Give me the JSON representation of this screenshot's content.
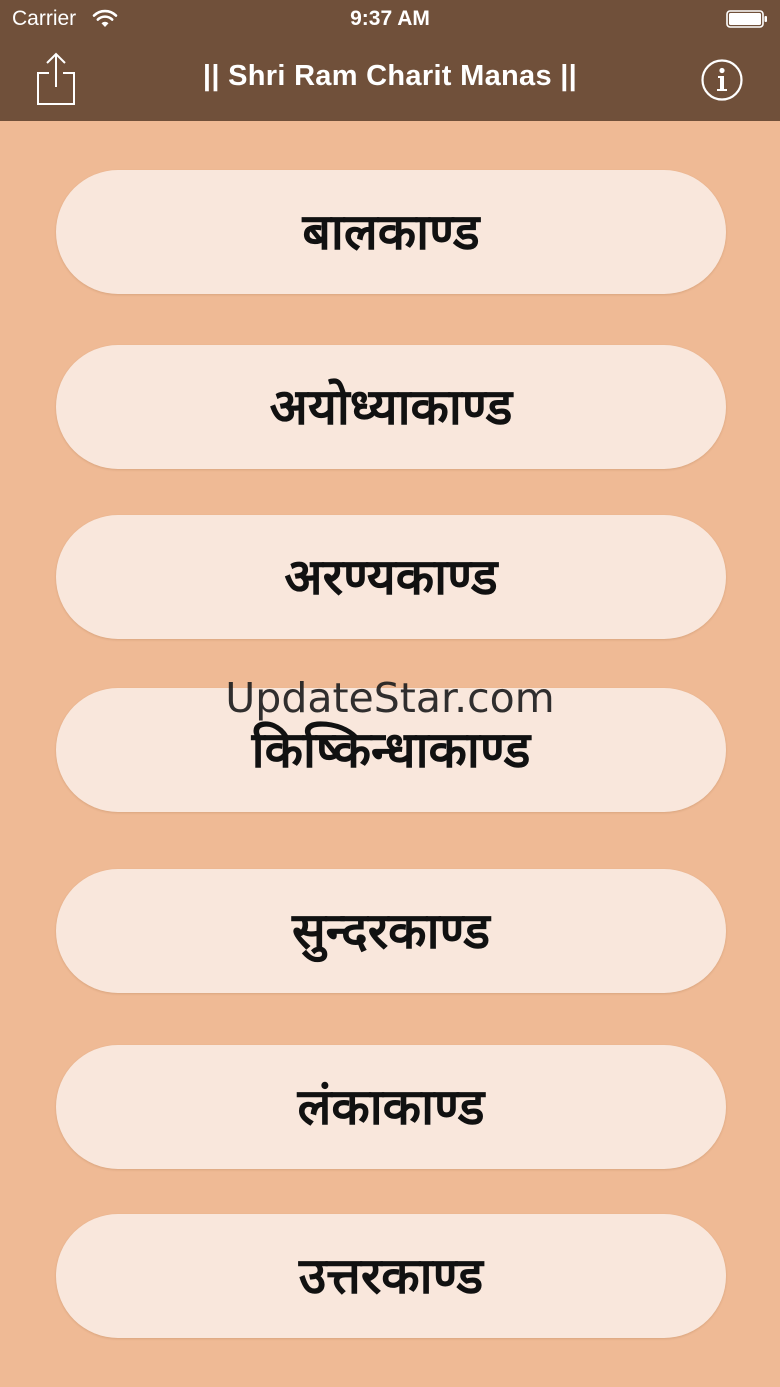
{
  "status_bar": {
    "carrier": "Carrier",
    "time": "9:37 AM"
  },
  "nav": {
    "title": "|| Shri Ram Charit Manas ||",
    "share_icon": "share-icon",
    "info_icon": "info-icon"
  },
  "kands": [
    {
      "label": "बालकाण्ड"
    },
    {
      "label": "अयोध्याकाण्ड"
    },
    {
      "label": "अरण्यकाण्ड"
    },
    {
      "label": "किष्किन्धाकाण्ड"
    },
    {
      "label": "सुन्दरकाण्ड"
    },
    {
      "label": "लंकाकाण्ड"
    },
    {
      "label": "उत्तरकाण्ड"
    }
  ],
  "watermark": "UpdateStar.com",
  "colors": {
    "nav_background": "#70503a",
    "page_background": "#efba95",
    "button_background": "#f9e7dc",
    "label_color": "#111111"
  }
}
